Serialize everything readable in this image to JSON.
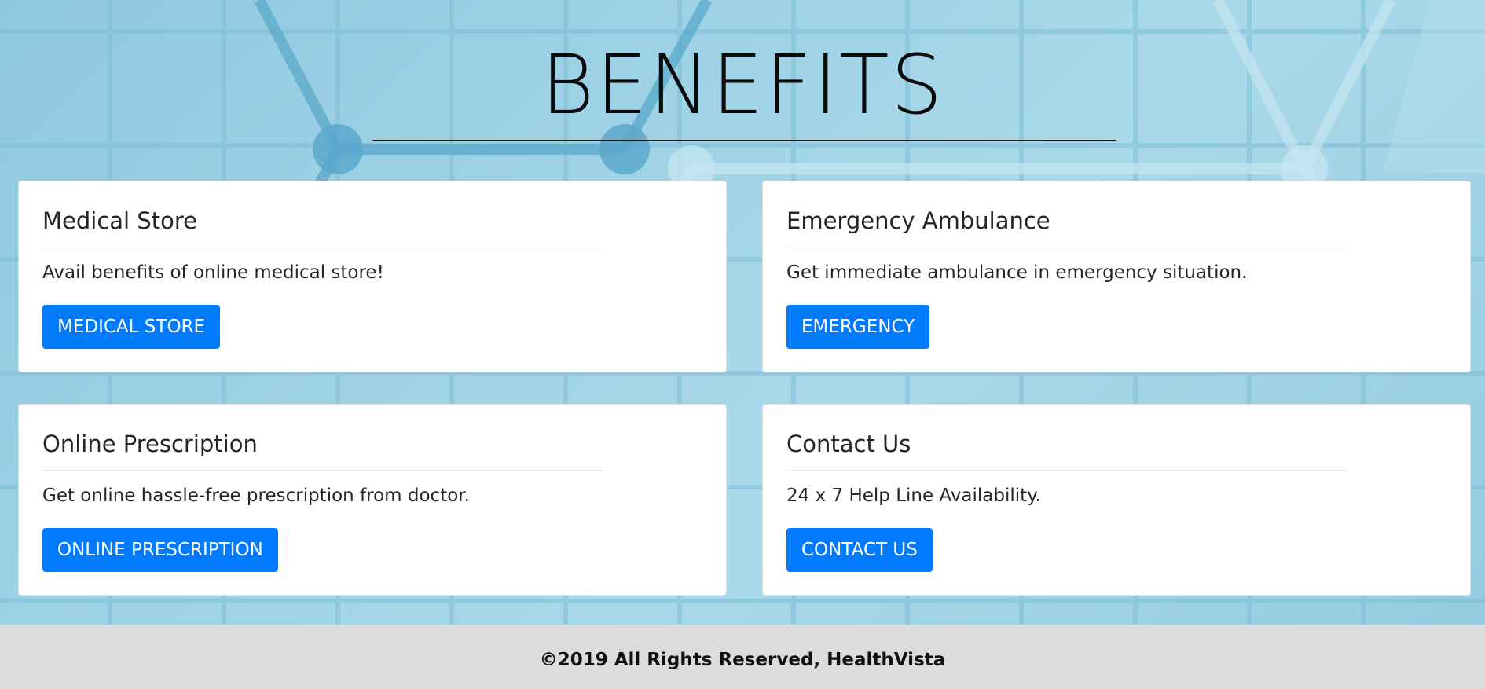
{
  "hero": {
    "title": "BENEFITS"
  },
  "cards": [
    {
      "title": "Medical Store",
      "text": "Avail benefits of online medical store!",
      "button": "MEDICAL STORE"
    },
    {
      "title": "Emergency Ambulance",
      "text": "Get immediate ambulance in emergency situation.",
      "button": "EMERGENCY"
    },
    {
      "title": "Online Prescription",
      "text": "Get online hassle-free prescription from doctor.",
      "button": "ONLINE PRESCRIPTION"
    },
    {
      "title": "Contact Us",
      "text": "24 x 7 Help Line Availability.",
      "button": "CONTACT US"
    }
  ],
  "footer": {
    "text": "©2019 All Rights Reserved, HealthVista"
  },
  "colors": {
    "primary": "#007bff",
    "footer_bg": "#dcdcdc",
    "background": "#9fd2e6"
  }
}
